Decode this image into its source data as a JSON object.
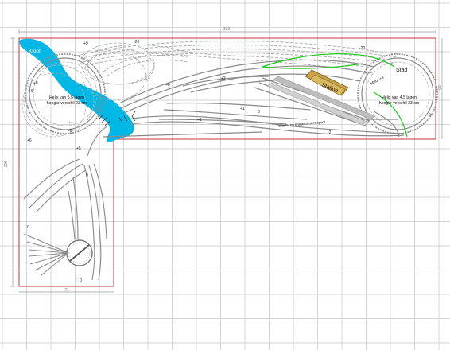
{
  "labels": {
    "kloof": "Kloof",
    "stad": "Stad",
    "station": "Station",
    "helix_left_line1": "Helix van 5,5 lagen",
    "helix_left_line2": "hoogte verschil 23 cm",
    "helix_right_line1": "Helix van 4,5 lagen",
    "helix_right_line2": "hoogte verschil 23 cm",
    "muur": "Muur +4",
    "parade": "Parade- en programmeer spoor"
  },
  "heights": {
    "h_m20_a": "-20",
    "h_m20_b": "-20",
    "h_p9": "+9",
    "h_p7": "+7",
    "h_p6_top": "+6",
    "h_p8": "+8",
    "h_p6_left": "+6",
    "h_p4": "+4",
    "h_m6": "-6",
    "h_p6_bottom": "+6",
    "h_p5": "+5",
    "h_p2": "+2",
    "h_p1_a": "+1",
    "h_p1_b": "+1",
    "h_m2": "-2",
    "h_zero_yard": "0",
    "h_zero_left": "0",
    "h_zero_bottom": "0",
    "h_zero_right": "0",
    "h_zero_mid": "0"
  },
  "dimensions": {
    "top_width": "330",
    "left_height": "205",
    "right_height": "80",
    "bottom_width": "71"
  },
  "colors": {
    "water": "#00b8e6",
    "grid": "#d4d4d4",
    "outline": "#c03a3a",
    "track": "#8a8a8a",
    "track_dash": "#a8a8a8",
    "wall": "#22cc22",
    "station_fill": "#d8b85c",
    "platform": "#bdbdbd"
  }
}
